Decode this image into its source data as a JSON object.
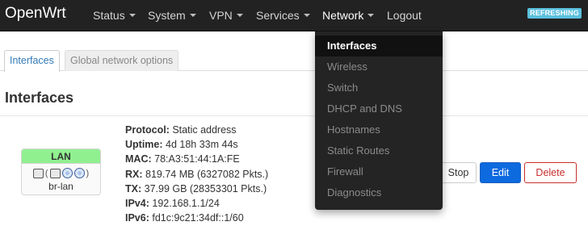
{
  "navbar": {
    "brand": "OpenWrt",
    "menu": [
      {
        "label": "Status",
        "dropdown": true
      },
      {
        "label": "System",
        "dropdown": true
      },
      {
        "label": "VPN",
        "dropdown": true
      },
      {
        "label": "Services",
        "dropdown": true
      },
      {
        "label": "Network",
        "dropdown": true
      },
      {
        "label": "Logout",
        "dropdown": false
      }
    ],
    "refresh_badge": "REFRESHING"
  },
  "tabs": [
    {
      "label": "Interfaces",
      "active": true
    },
    {
      "label": "Global network options",
      "active": false
    }
  ],
  "section_title": "Interfaces",
  "interface": {
    "name": "LAN",
    "device": "br-lan",
    "badge_color": "#90f090",
    "icons": [
      "ethernet-port-icon",
      "wireless-icon",
      "wireless-icon",
      "wireless-icon"
    ],
    "status": [
      {
        "label": "Protocol:",
        "value": "Static address"
      },
      {
        "label": "Uptime:",
        "value": "4d 18h 33m 44s"
      },
      {
        "label": "MAC:",
        "value": "78:A3:51:44:1A:FE"
      },
      {
        "label": "RX:",
        "value": "819.74 MB (6327082 Pkts.)"
      },
      {
        "label": "TX:",
        "value": "37.99 GB (28353301 Pkts.)"
      },
      {
        "label": "IPv4:",
        "value": "192.168.1.1/24"
      },
      {
        "label": "IPv6:",
        "value": "fd1c:9c21:34df::1/60"
      }
    ]
  },
  "buttons": {
    "stop": "Stop",
    "edit": "Edit",
    "delete": "Delete"
  },
  "network_dropdown": [
    {
      "label": "Interfaces",
      "active": true
    },
    {
      "label": "Wireless",
      "active": false
    },
    {
      "label": "Switch",
      "active": false
    },
    {
      "label": "DHCP and DNS",
      "active": false
    },
    {
      "label": "Hostnames",
      "active": false
    },
    {
      "label": "Static Routes",
      "active": false
    },
    {
      "label": "Firewall",
      "active": false
    },
    {
      "label": "Diagnostics",
      "active": false
    }
  ],
  "colors": {
    "navbar_bg": "#222222",
    "primary": "#0d6adf",
    "danger": "#c9302c",
    "refresh_badge": "#5bc0de"
  }
}
